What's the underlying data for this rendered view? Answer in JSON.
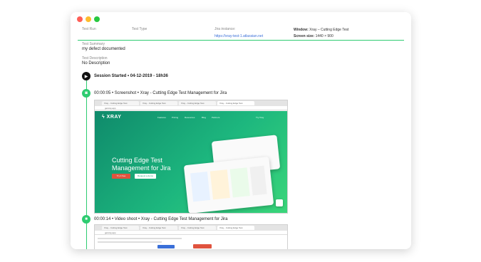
{
  "header": {
    "test_run_label": "Test Run",
    "test_type_label": "Test Type",
    "jira_instance_label": "Jira instance:",
    "jira_instance_value": "https://xray-test-1.atlassian.net",
    "window_label": "Window:",
    "window_value": "Xray – Cutting Edge Test",
    "screen_size_label": "Screen size:",
    "screen_size_value": "1440 × 900"
  },
  "summary": {
    "summary_label": "Test Summary",
    "summary_value": "my defect documented",
    "description_label": "Test Description",
    "description_value": "No Description"
  },
  "timeline": {
    "session": "Session Started • 04-12-2019 - 18h36",
    "event1": "00:00:05 • Screenshot • Xray - Cutting Edge Test Management for Jira",
    "event2": "00:00:14 • Video shoot • Xray - Cutting Edge Test Management for Jira"
  },
  "screenshot": {
    "tabs": [
      "Xray - Cutting Edge Test",
      "Xray - Cutting Edge Test",
      "Xray - Cutting Edge Test",
      "Xray - Cutting Edge Test"
    ],
    "url": "getxray.app",
    "logo": "XRAY",
    "nav": [
      "Features",
      "Pricing",
      "Resources",
      "Blog",
      "Partners"
    ],
    "try_label": "Try Xray",
    "hero_title": "Cutting Edge Test Management for Jira",
    "primary_button": "Try it free",
    "secondary_button": "Request a demo"
  },
  "colors": {
    "accent": "#2ecc71",
    "link": "#3a6fd8",
    "cta": "#e0533e"
  }
}
